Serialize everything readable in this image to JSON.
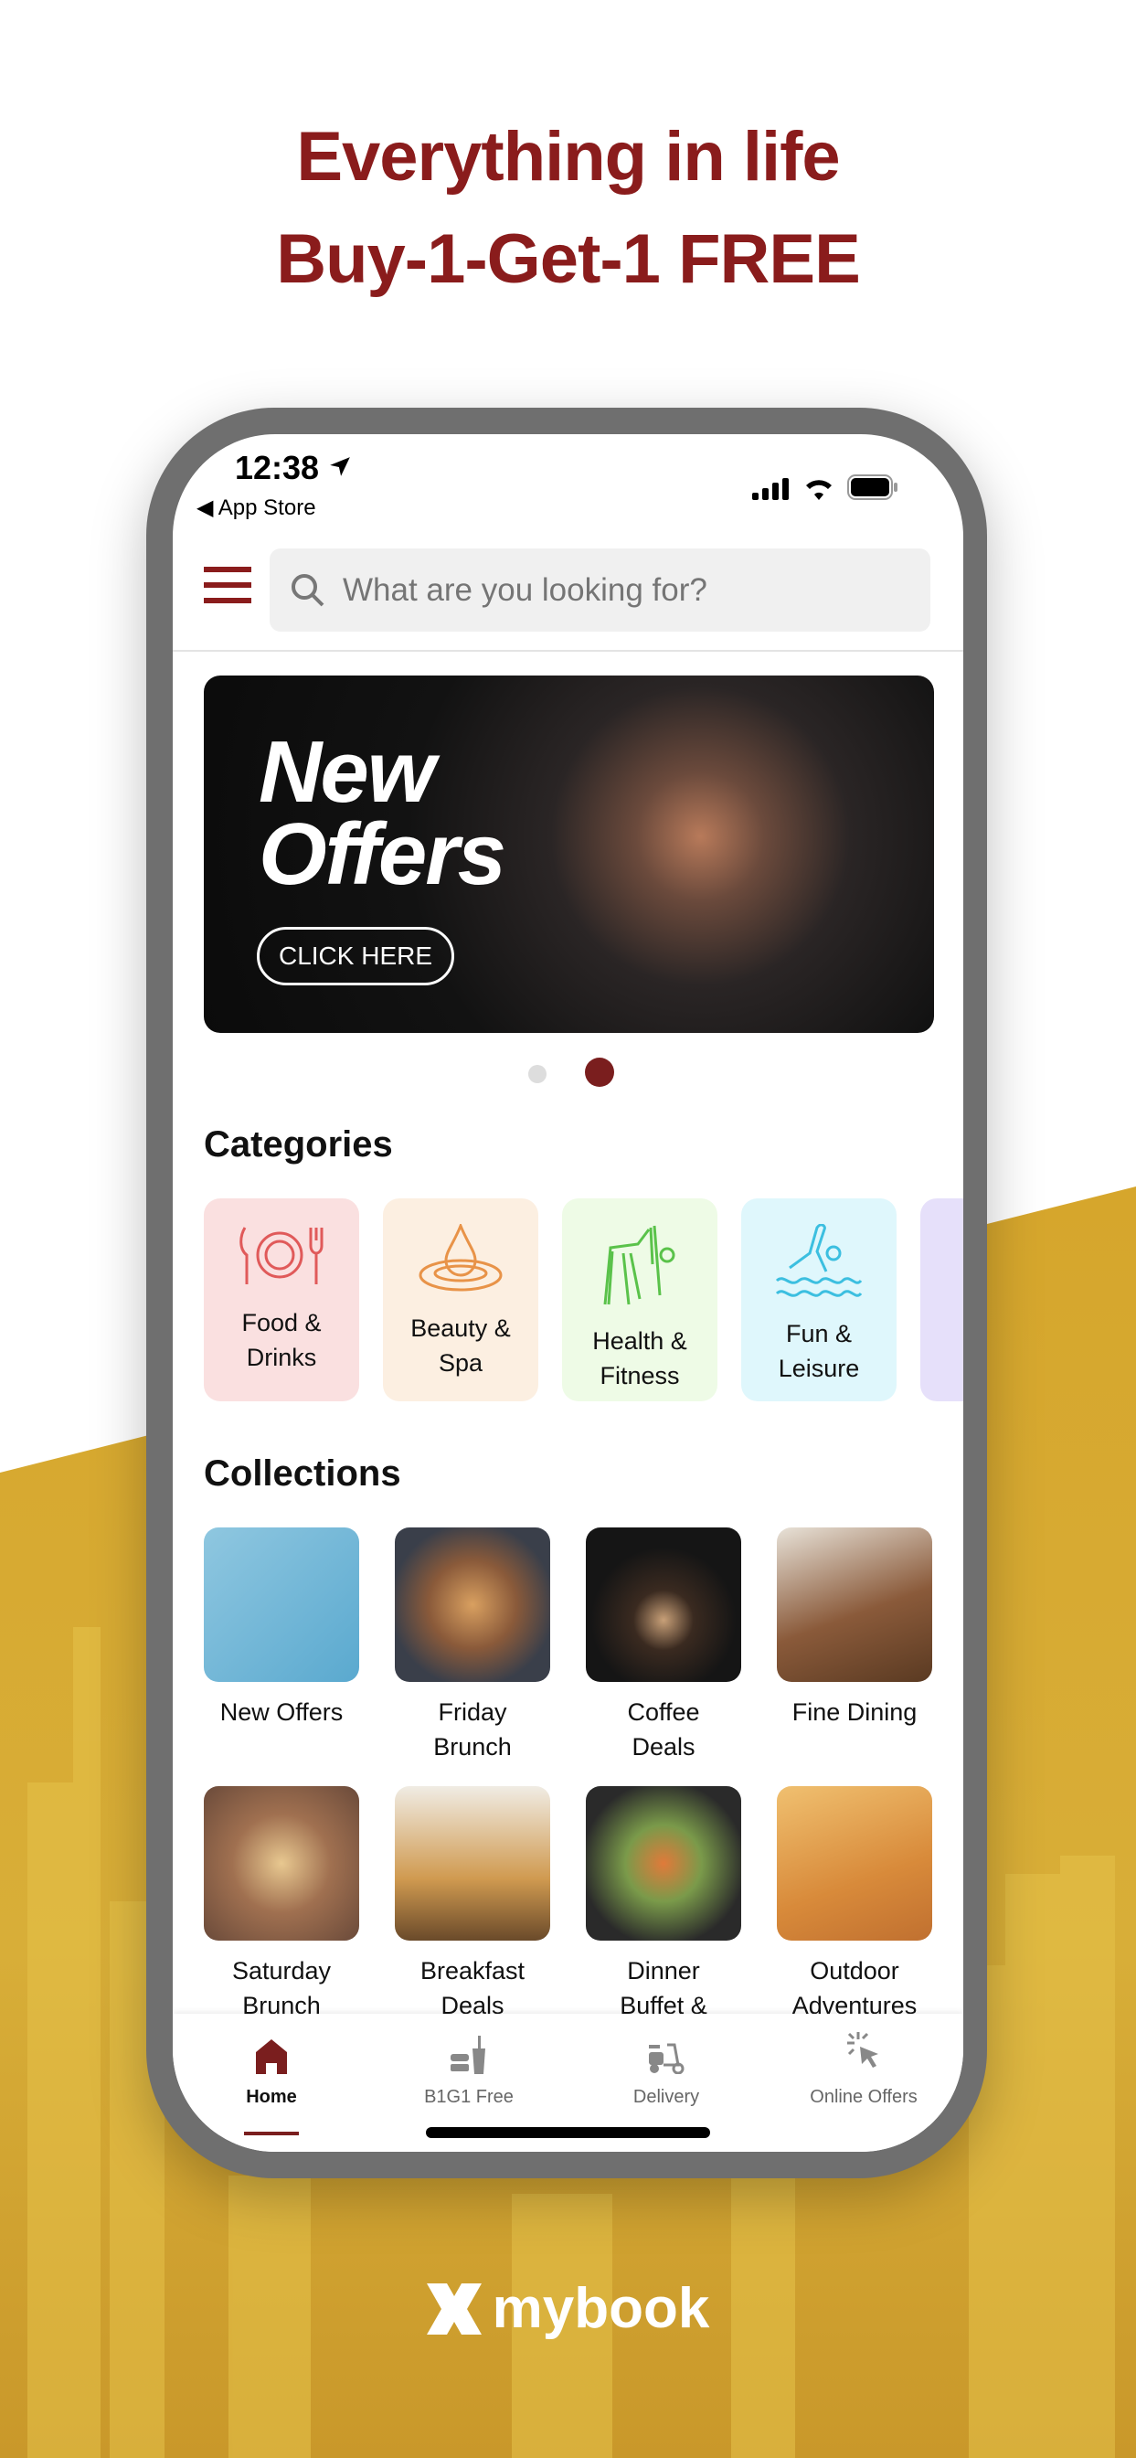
{
  "promo": {
    "line1": "Everything in life",
    "line2": "Buy-1-Get-1 FREE"
  },
  "colors": {
    "brand": "#8a1c1c",
    "gold": "#d4a62a",
    "frame": "#6f6f6f"
  },
  "status_bar": {
    "time": "12:38",
    "back_label": "◀ App Store",
    "icons": [
      "location-arrow-icon",
      "signal-icon",
      "wifi-icon",
      "battery-icon"
    ]
  },
  "header": {
    "menu_icon": "hamburger-icon",
    "search_placeholder": "What are you looking for?"
  },
  "banner": {
    "title_line1": "New",
    "title_line2": "Offers",
    "cta": "CLICK HERE",
    "active_slide": 2,
    "slide_count": 2
  },
  "categories": {
    "title": "Categories",
    "items": [
      {
        "label": "Food &\nDrinks",
        "icon": "plate-cutlery-icon",
        "bg": "#fae0e0",
        "color": "#e05a5a"
      },
      {
        "label": "Beauty &\nSpa",
        "icon": "water-drop-icon",
        "bg": "#fcefe1",
        "color": "#e89348"
      },
      {
        "label": "Health &\nFitness",
        "icon": "yoga-stretch-icon",
        "bg": "#eefbe6",
        "color": "#5ac24a"
      },
      {
        "label": "Fun &\nLeisure",
        "icon": "swimmer-icon",
        "bg": "#dff7fc",
        "color": "#3cbfe0"
      },
      {
        "label": "",
        "icon": "partial-icon",
        "bg": "#e6e0fa",
        "color": "#7a5ce0"
      }
    ]
  },
  "collections": {
    "title": "Collections",
    "items": [
      {
        "label": "New Offers",
        "image": "woman-megaphone-photo",
        "bg": "linear-gradient(135deg,#8fc7e0,#5aa9cf)"
      },
      {
        "label": "Friday\nBrunch",
        "image": "pancakes-photo",
        "bg": "radial-gradient(circle,#d9a060 0,#8a5a3a 40%,#3a3f4a 75%)"
      },
      {
        "label": "Coffee\nDeals",
        "image": "coffee-cup-photo",
        "bg": "radial-gradient(circle at 50% 60%,#c8a078 0,#3a2a20 25%,#151515 60%)"
      },
      {
        "label": "Fine Dining",
        "image": "steak-platter-photo",
        "bg": "linear-gradient(160deg,#e8e2d8,#8a5a3a 55%,#5a3a22)"
      },
      {
        "label": "Saturday\nBrunch",
        "image": "brunch-table-photo",
        "bg": "radial-gradient(circle,#e8c890 0,#a07050 45%,#6a4a3a)"
      },
      {
        "label": "Breakfast\nDeals",
        "image": "croissant-coffee-photo",
        "bg": "linear-gradient(180deg,#f0ece4,#d09a50 60%,#6a4a2a)"
      },
      {
        "label": "Dinner\nBuffet &",
        "image": "salad-meat-photo",
        "bg": "radial-gradient(circle,#e07a3a 0,#7a9a4a 35%,#2a2a2a 75%)"
      },
      {
        "label": "Outdoor\nAdventures",
        "image": "desert-car-photo",
        "bg": "linear-gradient(160deg,#f0c070,#d88a3a 60%,#c07030)"
      }
    ]
  },
  "bottom_nav": {
    "items": [
      {
        "label": "Home",
        "icon": "home-icon",
        "active": true
      },
      {
        "label": "B1G1 Free",
        "icon": "burger-drink-icon",
        "active": false
      },
      {
        "label": "Delivery",
        "icon": "scooter-icon",
        "active": false
      },
      {
        "label": "Online Offers",
        "icon": "cursor-click-icon",
        "active": false
      }
    ]
  },
  "brand_logo": {
    "text": "mybook"
  }
}
